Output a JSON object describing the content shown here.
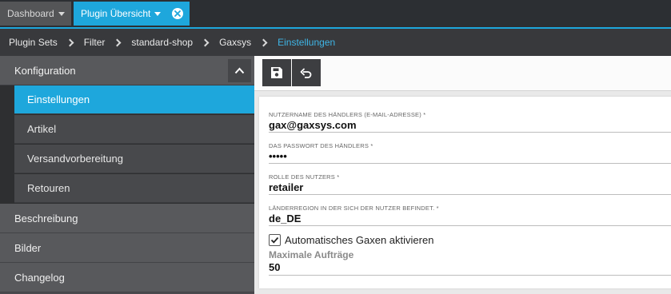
{
  "tabs": [
    {
      "label": "Dashboard"
    },
    {
      "label": "Plugin Übersicht"
    }
  ],
  "breadcrumb": [
    "Plugin Sets",
    "Filter",
    "standard-shop",
    "Gaxsys",
    "Einstellungen"
  ],
  "sidebar": {
    "section": "Konfiguration",
    "sub_items": [
      "Einstellungen",
      "Artikel",
      "Versandvorbereitung",
      "Retouren"
    ],
    "items": [
      "Beschreibung",
      "Bilder",
      "Changelog"
    ]
  },
  "form": {
    "fields": [
      {
        "label": "NUTZERNAME DES HÄNDLERS (E-MAIL-ADRESSE) *",
        "value": "gax@gaxsys.com"
      },
      {
        "label": "DAS PASSWORT DES HÄNDLERS *",
        "value": "•••••"
      },
      {
        "label": "ROLLE DES NUTZERS *",
        "value": "retailer"
      },
      {
        "label": "LÄNDERREGION IN DER SICH DER NUTZER BEFINDET. *",
        "value": "de_DE"
      }
    ],
    "checkbox_label": "Automatisches Gaxen aktivieren",
    "checkbox_checked": true,
    "max_orders_label": "Maximale Aufträge",
    "max_orders_value": "50"
  },
  "colors": {
    "accent": "#1ea7dc",
    "tabbar_bg": "#2c2f33",
    "sidebar_bg": "#58595c"
  }
}
